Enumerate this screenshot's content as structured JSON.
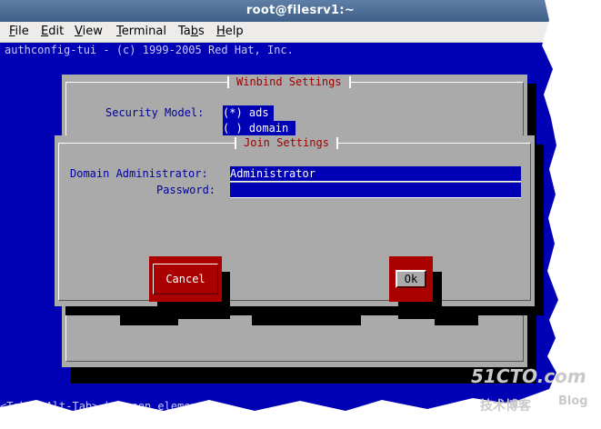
{
  "window": {
    "title": "root@filesrv1:~"
  },
  "menu": {
    "items": [
      {
        "underline": "F",
        "rest": "ile"
      },
      {
        "underline": "E",
        "rest": "dit"
      },
      {
        "underline": "V",
        "rest": "iew"
      },
      {
        "underline": "T",
        "rest": "erminal"
      },
      {
        "pre": "Ta",
        "underline": "b",
        "rest": "s"
      },
      {
        "underline": "H",
        "rest": "elp"
      }
    ]
  },
  "terminal": {
    "header_line": "authconfig-tui - (c) 1999-2005 Red Hat, Inc.",
    "footer_line": "<Tab>/<Alt-Tab> between elements"
  },
  "winbind": {
    "title": "Winbind Settings",
    "security_label": "Security Model:",
    "options": [
      "(*) ads",
      "( ) domain"
    ]
  },
  "join": {
    "title": "Join Settings",
    "admin_label": "Domain Administrator:",
    "admin_value": "Administrator",
    "password_label": "Password:",
    "password_value": "",
    "cancel_label": "Cancel",
    "ok_label": "Ok"
  },
  "watermark": {
    "site": "51CTO.com",
    "sub": "技术博客",
    "blog": "Blog"
  },
  "colors": {
    "terminal_bg": "#0000b4",
    "dialog_bg": "#aaaaaa",
    "button_red": "#aa0000",
    "title_red": "#a00000"
  }
}
